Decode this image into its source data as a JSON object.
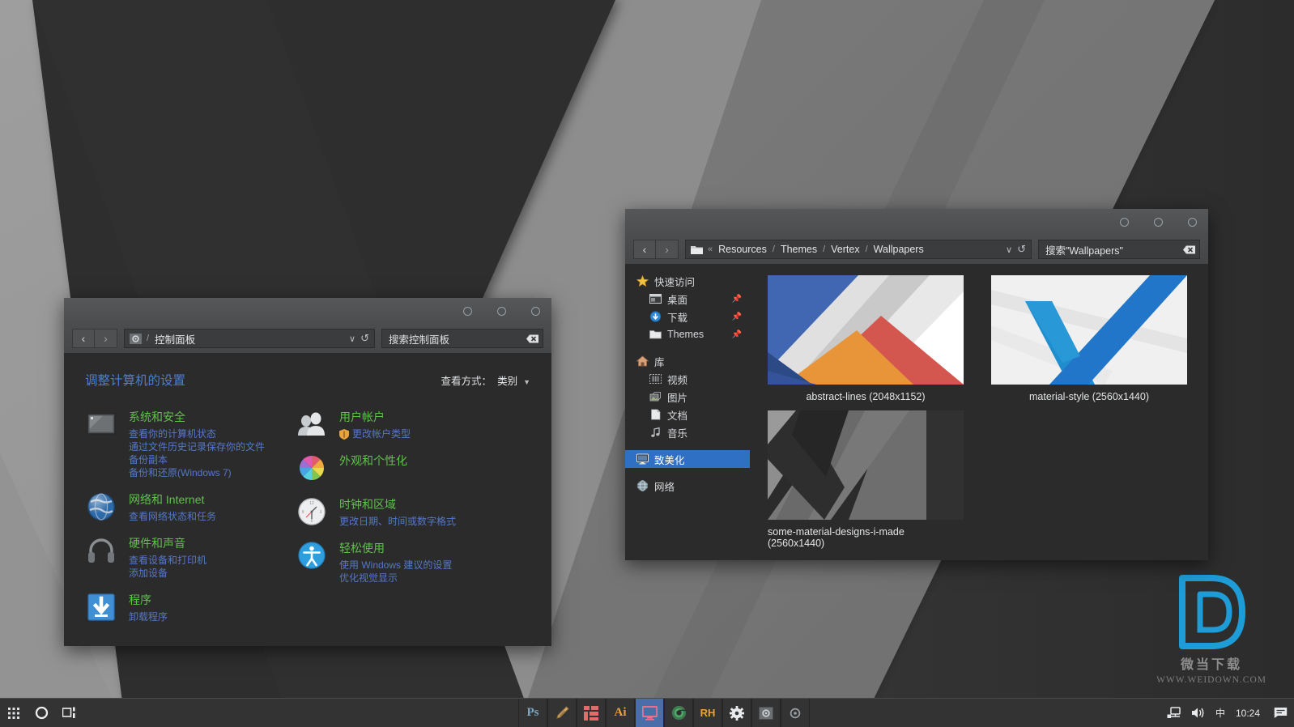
{
  "desktop": {
    "wallpaper_name": "material-design-grey-wallpaper",
    "colors": {
      "light_grey": "#9a9a9a",
      "mid_grey": "#787878",
      "dark_grey": "#4c4c4c",
      "near_black": "#2b2b2b",
      "accent_blue": "#1e9cd7"
    }
  },
  "explorer": {
    "window_name": "File Explorer",
    "nav": {
      "back": "‹",
      "forward": "›",
      "refresh": "↺",
      "dropdown": "∨"
    },
    "breadcrumb": {
      "icon": "folder-icon",
      "overflow": "«",
      "items": [
        "Resources",
        "Themes",
        "Vertex",
        "Wallpapers"
      ],
      "separator": "/"
    },
    "search": {
      "placeholder": "搜索\"Wallpapers\"",
      "value": "搜索\"Wallpapers\""
    },
    "sidebar": [
      {
        "label": "快速访问",
        "icon": "star-icon",
        "indent": false,
        "pinned": false,
        "selected": false
      },
      {
        "label": "桌面",
        "icon": "desktop-icon",
        "indent": true,
        "pinned": true,
        "selected": false
      },
      {
        "label": "下载",
        "icon": "download-icon",
        "indent": true,
        "pinned": true,
        "selected": false
      },
      {
        "label": "Themes",
        "icon": "folder-icon",
        "indent": true,
        "pinned": true,
        "selected": false
      },
      {
        "label": "库",
        "icon": "home-icon",
        "indent": false,
        "pinned": false,
        "selected": false
      },
      {
        "label": "视频",
        "icon": "video-icon",
        "indent": true,
        "pinned": false,
        "selected": false
      },
      {
        "label": "图片",
        "icon": "pictures-icon",
        "indent": true,
        "pinned": false,
        "selected": false
      },
      {
        "label": "文档",
        "icon": "documents-icon",
        "indent": true,
        "pinned": false,
        "selected": false
      },
      {
        "label": "音乐",
        "icon": "music-icon",
        "indent": true,
        "pinned": false,
        "selected": false
      },
      {
        "label": "致美化",
        "icon": "monitor-icon",
        "indent": false,
        "pinned": false,
        "selected": true
      },
      {
        "label": "网络",
        "icon": "network-icon",
        "indent": false,
        "pinned": false,
        "selected": false
      }
    ],
    "files": [
      {
        "label": "abstract-lines (2048x1152)",
        "thumb": "abstract-lines"
      },
      {
        "label": "material-style (2560x1440)",
        "thumb": "material-style"
      },
      {
        "label": "some-material-designs-i-made (2560x1440)",
        "thumb": "some-material-designs"
      }
    ]
  },
  "control_panel": {
    "window_name": "控制面板",
    "nav": {
      "back": "‹",
      "forward": "›",
      "refresh": "↺",
      "dropdown": "∨"
    },
    "breadcrumb": {
      "icon": "control-panel-icon",
      "items": [
        "控制面板"
      ],
      "separator": "/"
    },
    "search": {
      "placeholder": "搜索控制面板",
      "value": "搜索控制面板"
    },
    "title": "调整计算机的设置",
    "view_by_label": "查看方式：",
    "view_by_value": "类别",
    "left_column": [
      {
        "category": "系统和安全",
        "icon": "system-security-icon",
        "links": [
          "查看你的计算机状态",
          "通过文件历史记录保存你的文件备份副本",
          "备份和还原(Windows 7)"
        ]
      },
      {
        "category": "网络和 Internet",
        "icon": "network-internet-icon",
        "links": [
          "查看网络状态和任务"
        ]
      },
      {
        "category": "硬件和声音",
        "icon": "hardware-sound-icon",
        "links": [
          "查看设备和打印机",
          "添加设备"
        ]
      },
      {
        "category": "程序",
        "icon": "programs-icon",
        "links": [
          "卸载程序"
        ]
      }
    ],
    "right_column": [
      {
        "category": "用户帐户",
        "icon": "user-accounts-icon",
        "links": [
          "更改帐户类型"
        ],
        "shield_first": true
      },
      {
        "category": "外观和个性化",
        "icon": "appearance-icon",
        "links": []
      },
      {
        "category": "时钟和区域",
        "icon": "clock-region-icon",
        "links": [
          "更改日期、时间或数字格式"
        ]
      },
      {
        "category": "轻松使用",
        "icon": "ease-of-access-icon",
        "links": [
          "使用 Windows 建议的设置",
          "优化视觉显示"
        ]
      }
    ]
  },
  "taskbar": {
    "start": {
      "icon": "grid-start-icon"
    },
    "cortana": {
      "icon": "circle-search-icon"
    },
    "taskview": {
      "icon": "task-view-icon"
    },
    "apps": [
      {
        "name": "photoshop",
        "label": "Ps",
        "color": "#7fa7c4",
        "active": false
      },
      {
        "name": "brush-tool",
        "label": "",
        "color": "#d6a96b",
        "active": false
      },
      {
        "name": "grid-app",
        "label": "",
        "color": "#e06c6c",
        "active": false
      },
      {
        "name": "illustrator",
        "label": "Ai",
        "color": "#e8a23c",
        "active": false
      },
      {
        "name": "display-settings",
        "label": "",
        "color": "#e06c8c",
        "active": true
      },
      {
        "name": "chrome",
        "label": "",
        "color": "#4fa868",
        "active": false
      },
      {
        "name": "resource-hacker",
        "label": "RH",
        "color": "#e8a23c",
        "active": false
      },
      {
        "name": "settings-gear",
        "label": "",
        "color": "#e8eaec",
        "active": false
      },
      {
        "name": "control-panel-app",
        "label": "",
        "color": "#9aa0a3",
        "active": false
      },
      {
        "name": "utility-gear",
        "label": "",
        "color": "#9aa0a3",
        "active": false
      }
    ],
    "tray": {
      "network_icon": "network-tray-icon",
      "volume_icon": "volume-icon",
      "ime": "中",
      "time": "10:24",
      "notification_icon": "notification-icon"
    }
  },
  "watermark": {
    "logo": "D",
    "chinese": "微当下载",
    "url": "WWW.WEIDOWN.COM",
    "color": "#1e9cd7"
  }
}
